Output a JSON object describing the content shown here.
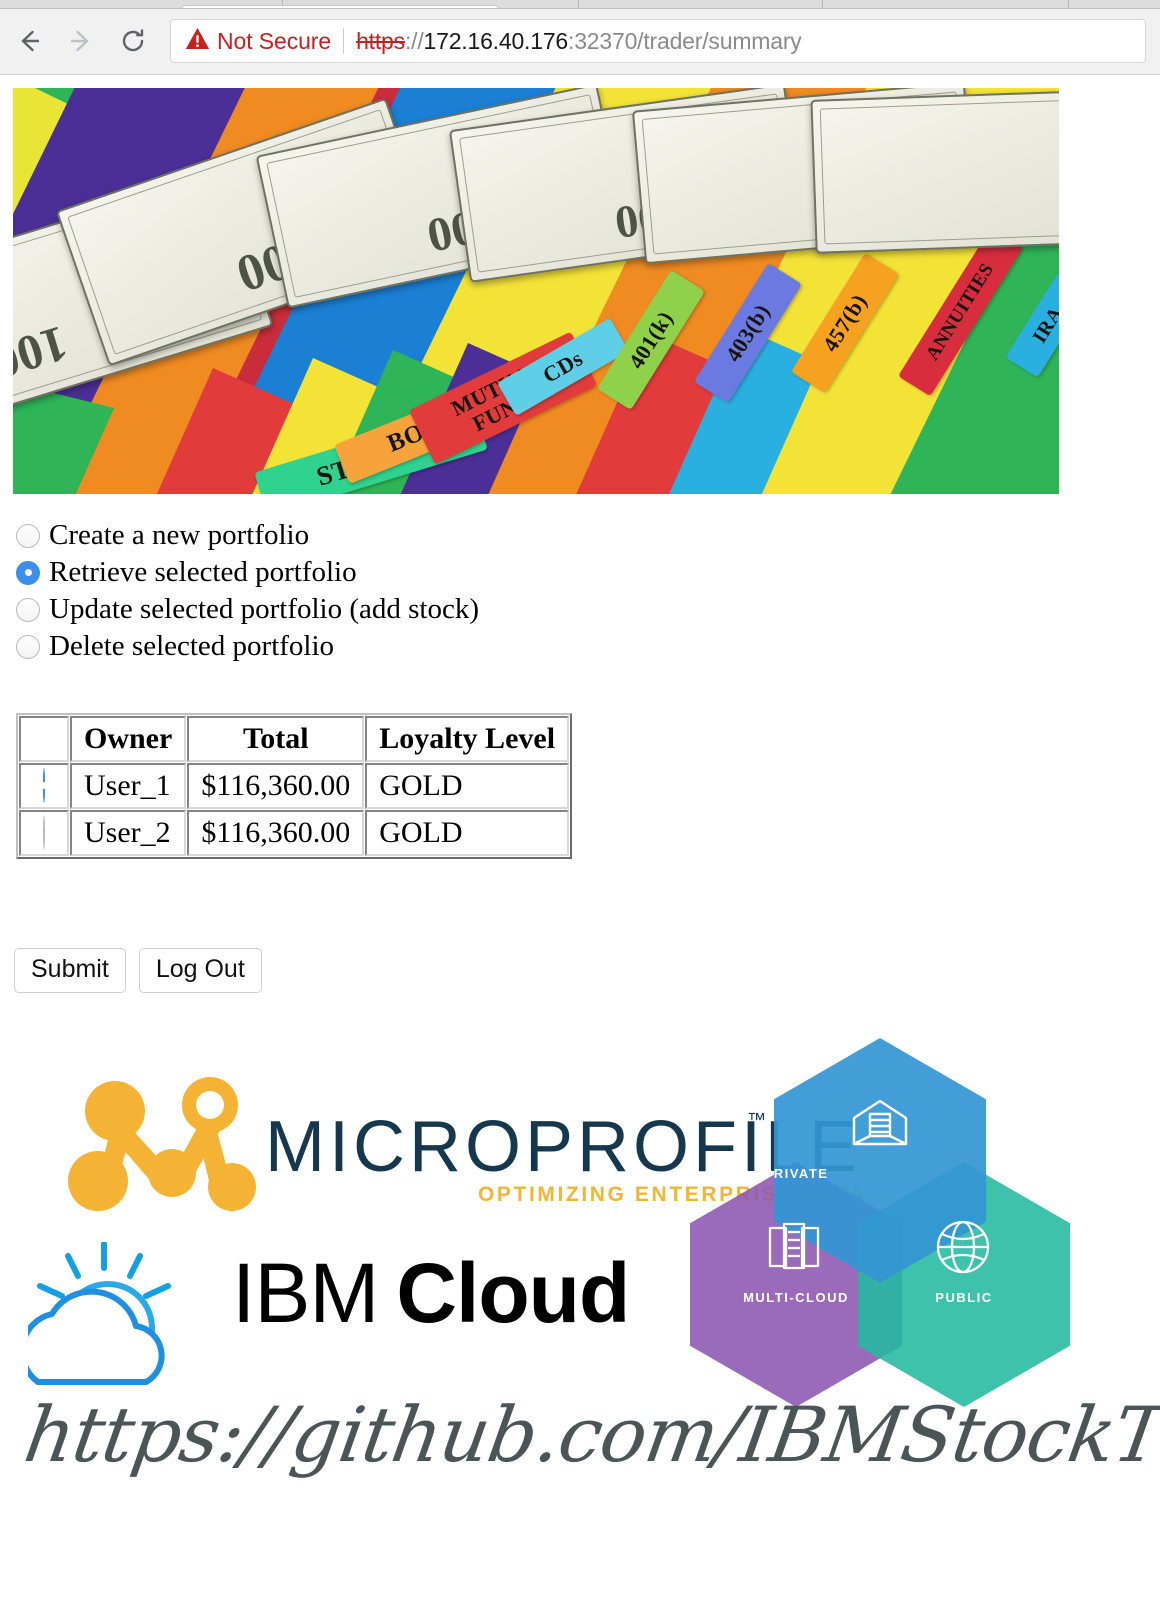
{
  "browser": {
    "back_icon": "back-arrow-icon",
    "forward_icon": "forward-arrow-icon",
    "reload_icon": "reload-icon",
    "security_warning_icon": "warning-triangle-icon",
    "security_label": "Not Secure",
    "url": {
      "full": "https://172.16.40.176:32370/trader/summary",
      "scheme": "https",
      "separator": "://",
      "host": "172.16.40.176",
      "rest": ":32370/trader/summary"
    },
    "colors": {
      "insecure_red": "#c5221f",
      "chrome_bg": "#f1f1f1",
      "url_dim": "#8a8a8a"
    }
  },
  "banner": {
    "name": "investment-folders-photo",
    "alt": "US hundred dollar bills fanned over colored file folder tabs",
    "folder_tabs": [
      "STOCKS",
      "BONDS",
      "MUTUAL FUNDS",
      "CDs",
      "401(k)",
      "403(b)",
      "457(b)",
      "ANNUITIES",
      "IRA"
    ],
    "bill_denomination": "100"
  },
  "options": {
    "selected": "retrieve",
    "items": [
      {
        "id": "create",
        "label": "Create a new portfolio",
        "checked": false
      },
      {
        "id": "retrieve",
        "label": "Retrieve selected portfolio",
        "checked": true
      },
      {
        "id": "update",
        "label": "Update selected portfolio (add stock)",
        "checked": false
      },
      {
        "id": "delete",
        "label": "Delete selected portfolio",
        "checked": false
      }
    ]
  },
  "table": {
    "columns": [
      "",
      "Owner",
      "Total",
      "Loyalty Level"
    ],
    "rows": [
      {
        "selected": true,
        "owner": "User_1",
        "total": "$116,360.00",
        "loyalty": "GOLD"
      },
      {
        "selected": false,
        "owner": "User_2",
        "total": "$116,360.00",
        "loyalty": "GOLD"
      }
    ]
  },
  "buttons": {
    "submit_label": "Submit",
    "logout_label": "Log Out"
  },
  "footer": {
    "microprofile": {
      "wordmark": "MICROPROFILE",
      "trademark": "™",
      "tagline": "OPTIMIZING ENTERPRISE JAVA",
      "mark_color": "#f5b335",
      "word_color": "#16384f"
    },
    "ibm_cloud": {
      "ibm": "IBM",
      "cloud": "Cloud",
      "cloud_icon": "sun-cloud-icon"
    },
    "hexagons": [
      {
        "id": "private",
        "label": "PRIVATE",
        "icon": "warehouse-icon",
        "color": "#3396d4"
      },
      {
        "id": "multi-cloud",
        "label": "MULTI-CLOUD",
        "icon": "servers-icon",
        "color": "#8c57b0"
      },
      {
        "id": "public",
        "label": "PUBLIC",
        "icon": "globe-icon",
        "color": "#23baa1"
      }
    ],
    "github_url": "https://github.com/IBMStockTrader"
  }
}
